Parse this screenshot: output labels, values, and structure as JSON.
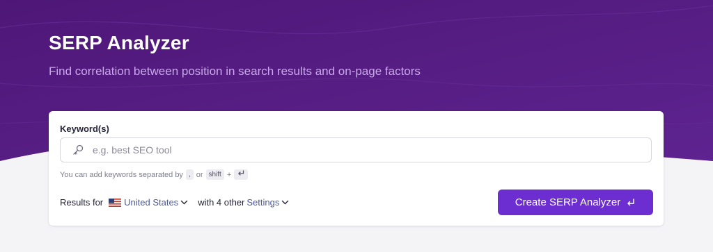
{
  "header": {
    "title": "SERP Analyzer",
    "subtitle": "Find correlation between position in search results and on-page factors"
  },
  "form": {
    "keyword_label": "Keyword(s)",
    "keyword_placeholder": "e.g. best SEO tool",
    "keyword_value": "",
    "hint_text": "You can add keywords separated by",
    "hint_comma": ",",
    "hint_or": "or",
    "hint_shift": "shift",
    "hint_plus": "+",
    "results_for": "Results for",
    "country": "United States",
    "with_other": "with 4 other",
    "settings": "Settings",
    "submit_label": "Create SERP Analyzer"
  },
  "colors": {
    "hero_purple": "#5a1c86",
    "cta_purple": "#6c2ed0",
    "link_blue": "#4a5a9a"
  },
  "icons": {
    "search_prefix": "key-icon",
    "country_flag": "us-flag-icon",
    "dropdown": "chevron-down-icon",
    "submit": "enter-icon"
  }
}
